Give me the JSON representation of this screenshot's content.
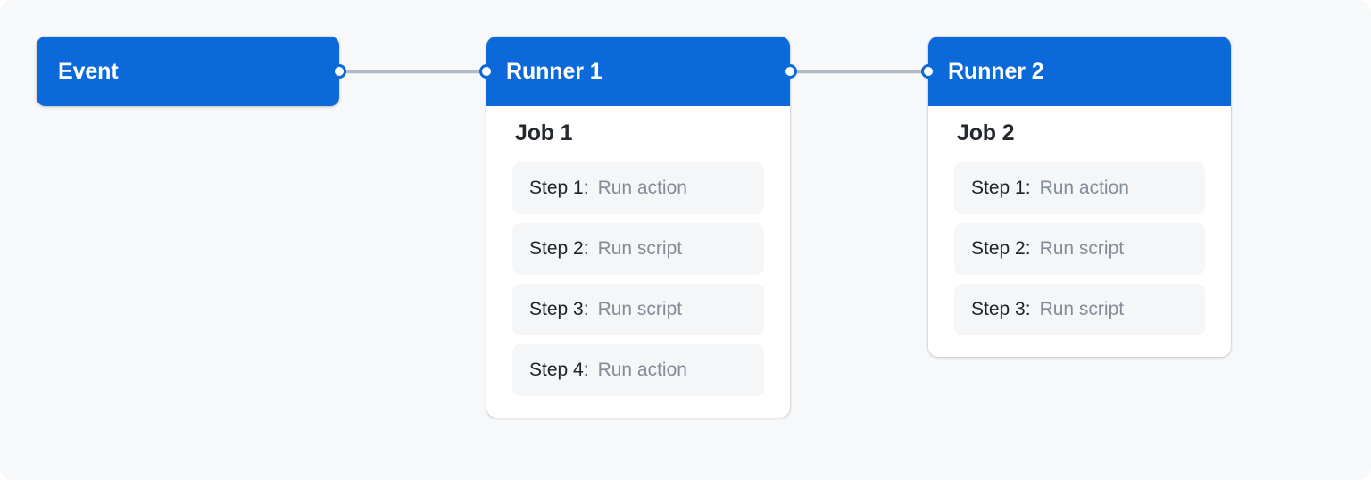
{
  "canvas": {
    "background": "#f6f8fa",
    "edge_color": "#b1bac5",
    "accent": "#0b69da",
    "card_background": "#ffffff",
    "step_background": "#f4f6f8",
    "step_label_color": "#1f2328",
    "step_value_color": "#848d97"
  },
  "nodes": {
    "event": {
      "title": "Event"
    },
    "runner1": {
      "title": "Runner 1",
      "job": "Job 1",
      "steps": [
        {
          "label": "Step 1:",
          "value": "Run action"
        },
        {
          "label": "Step 2:",
          "value": "Run script"
        },
        {
          "label": "Step 3:",
          "value": "Run script"
        },
        {
          "label": "Step 4:",
          "value": "Run action"
        }
      ]
    },
    "runner2": {
      "title": "Runner 2",
      "job": "Job 2",
      "steps": [
        {
          "label": "Step 1:",
          "value": "Run action"
        },
        {
          "label": "Step 2:",
          "value": "Run script"
        },
        {
          "label": "Step 3:",
          "value": "Run script"
        }
      ]
    }
  },
  "edges": [
    {
      "from": "event",
      "to": "runner1"
    },
    {
      "from": "runner1",
      "to": "runner2"
    }
  ]
}
